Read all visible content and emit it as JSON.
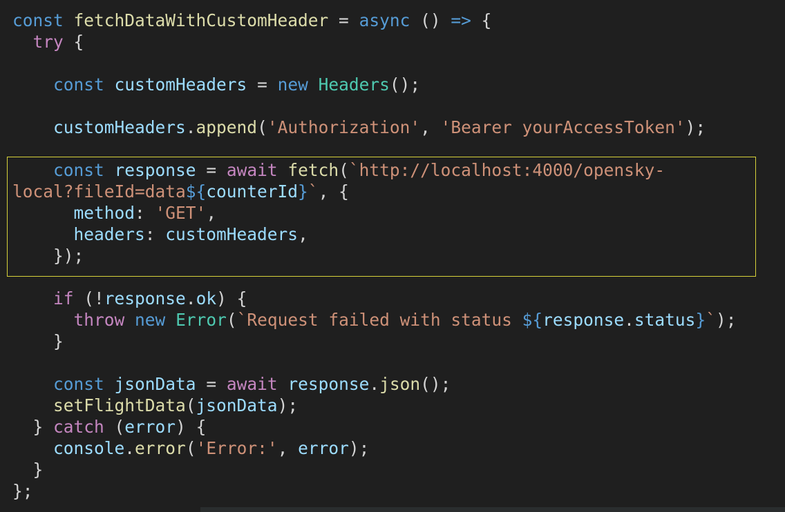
{
  "editor": {
    "lines": [
      [
        {
          "t": "const",
          "c": "kw"
        },
        {
          "t": " ",
          "c": "pun"
        },
        {
          "t": "fetchDataWithCustomHeader",
          "c": "fn"
        },
        {
          "t": " = ",
          "c": "pun"
        },
        {
          "t": "async",
          "c": "kw"
        },
        {
          "t": " () ",
          "c": "pun"
        },
        {
          "t": "=>",
          "c": "kw"
        },
        {
          "t": " {",
          "c": "pun"
        }
      ],
      [
        {
          "t": "  ",
          "c": "pun"
        },
        {
          "t": "try",
          "c": "ctl"
        },
        {
          "t": " {",
          "c": "pun"
        }
      ],
      [],
      [
        {
          "t": "    ",
          "c": "pun"
        },
        {
          "t": "const",
          "c": "kw"
        },
        {
          "t": " ",
          "c": "pun"
        },
        {
          "t": "customHeaders",
          "c": "var"
        },
        {
          "t": " = ",
          "c": "pun"
        },
        {
          "t": "new",
          "c": "kw"
        },
        {
          "t": " ",
          "c": "pun"
        },
        {
          "t": "Headers",
          "c": "cls"
        },
        {
          "t": "();",
          "c": "pun"
        }
      ],
      [],
      [
        {
          "t": "    ",
          "c": "pun"
        },
        {
          "t": "customHeaders",
          "c": "var"
        },
        {
          "t": ".",
          "c": "pun"
        },
        {
          "t": "append",
          "c": "fn"
        },
        {
          "t": "(",
          "c": "pun"
        },
        {
          "t": "'Authorization'",
          "c": "str"
        },
        {
          "t": ", ",
          "c": "pun"
        },
        {
          "t": "'Bearer yourAccessToken'",
          "c": "str"
        },
        {
          "t": ");",
          "c": "pun"
        }
      ],
      [],
      [
        {
          "t": "    ",
          "c": "pun"
        },
        {
          "t": "const",
          "c": "kw"
        },
        {
          "t": " ",
          "c": "pun"
        },
        {
          "t": "response",
          "c": "var"
        },
        {
          "t": " = ",
          "c": "pun"
        },
        {
          "t": "await",
          "c": "ctl"
        },
        {
          "t": " ",
          "c": "pun"
        },
        {
          "t": "fetch",
          "c": "fn"
        },
        {
          "t": "(",
          "c": "pun"
        },
        {
          "t": "`http://localhost:4000/opensky-",
          "c": "str"
        }
      ],
      [
        {
          "t": "local?fileId=data",
          "c": "str"
        },
        {
          "t": "${",
          "c": "interp"
        },
        {
          "t": "counterId",
          "c": "var"
        },
        {
          "t": "}",
          "c": "interp"
        },
        {
          "t": "`",
          "c": "str"
        },
        {
          "t": ", {",
          "c": "pun"
        }
      ],
      [
        {
          "t": "      ",
          "c": "pun"
        },
        {
          "t": "method",
          "c": "var"
        },
        {
          "t": ": ",
          "c": "pun"
        },
        {
          "t": "'GET'",
          "c": "str"
        },
        {
          "t": ",",
          "c": "pun"
        }
      ],
      [
        {
          "t": "      ",
          "c": "pun"
        },
        {
          "t": "headers",
          "c": "var"
        },
        {
          "t": ": ",
          "c": "pun"
        },
        {
          "t": "customHeaders",
          "c": "var"
        },
        {
          "t": ",",
          "c": "pun"
        }
      ],
      [
        {
          "t": "    ",
          "c": "pun"
        },
        {
          "t": "});",
          "c": "pun"
        }
      ],
      [],
      [
        {
          "t": "    ",
          "c": "pun"
        },
        {
          "t": "if",
          "c": "ctl"
        },
        {
          "t": " (!",
          "c": "pun"
        },
        {
          "t": "response",
          "c": "var"
        },
        {
          "t": ".",
          "c": "pun"
        },
        {
          "t": "ok",
          "c": "var"
        },
        {
          "t": ") {",
          "c": "pun"
        }
      ],
      [
        {
          "t": "      ",
          "c": "pun"
        },
        {
          "t": "throw",
          "c": "ctl"
        },
        {
          "t": " ",
          "c": "pun"
        },
        {
          "t": "new",
          "c": "kw"
        },
        {
          "t": " ",
          "c": "pun"
        },
        {
          "t": "Error",
          "c": "cls"
        },
        {
          "t": "(",
          "c": "pun"
        },
        {
          "t": "`Request failed with status ",
          "c": "str"
        },
        {
          "t": "${",
          "c": "interp"
        },
        {
          "t": "response",
          "c": "var"
        },
        {
          "t": ".",
          "c": "pun"
        },
        {
          "t": "status",
          "c": "var"
        },
        {
          "t": "}",
          "c": "interp"
        },
        {
          "t": "`",
          "c": "str"
        },
        {
          "t": ");",
          "c": "pun"
        }
      ],
      [
        {
          "t": "    }",
          "c": "pun"
        }
      ],
      [],
      [
        {
          "t": "    ",
          "c": "pun"
        },
        {
          "t": "const",
          "c": "kw"
        },
        {
          "t": " ",
          "c": "pun"
        },
        {
          "t": "jsonData",
          "c": "var"
        },
        {
          "t": " = ",
          "c": "pun"
        },
        {
          "t": "await",
          "c": "ctl"
        },
        {
          "t": " ",
          "c": "pun"
        },
        {
          "t": "response",
          "c": "var"
        },
        {
          "t": ".",
          "c": "pun"
        },
        {
          "t": "json",
          "c": "fn"
        },
        {
          "t": "();",
          "c": "pun"
        }
      ],
      [
        {
          "t": "    ",
          "c": "pun"
        },
        {
          "t": "setFlightData",
          "c": "fn"
        },
        {
          "t": "(",
          "c": "pun"
        },
        {
          "t": "jsonData",
          "c": "var"
        },
        {
          "t": ");",
          "c": "pun"
        }
      ],
      [
        {
          "t": "  } ",
          "c": "pun"
        },
        {
          "t": "catch",
          "c": "ctl"
        },
        {
          "t": " (",
          "c": "pun"
        },
        {
          "t": "error",
          "c": "var"
        },
        {
          "t": ") {",
          "c": "pun"
        }
      ],
      [
        {
          "t": "    ",
          "c": "pun"
        },
        {
          "t": "console",
          "c": "var"
        },
        {
          "t": ".",
          "c": "pun"
        },
        {
          "t": "error",
          "c": "fn"
        },
        {
          "t": "(",
          "c": "pun"
        },
        {
          "t": "'Error:'",
          "c": "str"
        },
        {
          "t": ", ",
          "c": "pun"
        },
        {
          "t": "error",
          "c": "var"
        },
        {
          "t": ");",
          "c": "pun"
        }
      ],
      [
        {
          "t": "  }",
          "c": "pun"
        }
      ],
      [
        {
          "t": "};",
          "c": "pun"
        }
      ]
    ]
  },
  "colors": {
    "background": "#1f1f1f",
    "highlight_border": "#d7d23a"
  }
}
